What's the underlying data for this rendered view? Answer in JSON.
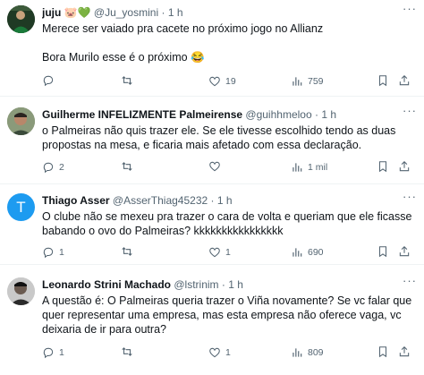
{
  "tweets": [
    {
      "name": "juju",
      "badges": "🐷💚",
      "handle": "@Ju_yosmini",
      "time": "1 h",
      "lines": [
        "Merece ser vaiado pra cacete no próximo jogo no Allianz",
        "",
        "Bora Murilo esse é o próximo 😂"
      ],
      "replies": "",
      "retweets": "",
      "likes": "19",
      "views": "759"
    },
    {
      "name": "Guilherme INFELIZMENTE Palmeirense",
      "handle": "@guihhmeloo",
      "time": "1 h",
      "lines": [
        "o Palmeiras não quis trazer ele. Se ele tivesse escolhido tendo as duas",
        "propostas na mesa, e ficaria mais afetado com essa declaração."
      ],
      "replies": "2",
      "retweets": "",
      "likes": "",
      "views": "1 mil"
    },
    {
      "name": "Thiago Asser",
      "handle": "@AsserThiag45232",
      "time": "1 h",
      "avatar_letter": "T",
      "lines": [
        "O clube não se mexeu pra trazer o cara de volta e queriam que ele ficasse",
        "babando o ovo do Palmeiras? kkkkkkkkkkkkkkkk"
      ],
      "replies": "1",
      "retweets": "",
      "likes": "1",
      "views": "690"
    },
    {
      "name": "Leonardo Strini Machado",
      "handle": "@lstrinim",
      "time": "1 h",
      "lines": [
        "A questão é: O Palmeiras queria trazer o Viña novamente? Se vc falar que",
        "quer representar uma empresa, mas esta empresa não oferece vaga, vc",
        "deixaria de ir para outra?"
      ],
      "replies": "1",
      "retweets": "",
      "likes": "1",
      "views": "809"
    }
  ],
  "icons": [
    "reply-icon",
    "retweet-icon",
    "like-icon",
    "views-icon",
    "bookmark-icon",
    "share-icon",
    "more-icon"
  ],
  "colors": {
    "text": "#0f1419",
    "muted": "#536471",
    "border": "#eff3f4",
    "avatar_t": "#1d9bf0"
  }
}
